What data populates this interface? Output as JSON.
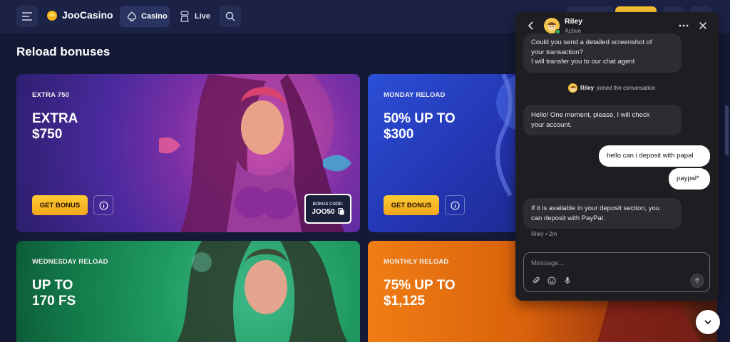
{
  "header": {
    "brand": "JooCasino",
    "nav": {
      "casino": "Casino",
      "live": "Live"
    }
  },
  "page": {
    "title": "Reload bonuses"
  },
  "cards": [
    {
      "label": "EXTRA 750",
      "headline_1": "EXTRA",
      "headline_2": "$750",
      "button": "GET BONUS",
      "code_label": "BONUS CODE:",
      "code": "JOO50"
    },
    {
      "label": "MONDAY RELOAD",
      "headline_1": "50% UP TO",
      "headline_2": "$300",
      "button": "GET BONUS"
    },
    {
      "label": "WEDNESDAY RELOAD",
      "headline_1": "UP TO",
      "headline_2": "170 FS"
    },
    {
      "label": "MONTHLY RELOAD",
      "headline_1": "75% UP TO",
      "headline_2": "$1,125"
    }
  ],
  "chat": {
    "agent_name": "Riley",
    "agent_status": "Active",
    "messages": [
      {
        "line1": "Could you send a detailed screenshot of",
        "line2": "your transaction?",
        "line3": "I will transfer you to our chat agent"
      },
      {
        "system_name": "Riley",
        "system_text": "joined the conversation"
      },
      {
        "line1": "Hello! One moment, please, I will check",
        "line2": "your account."
      },
      {
        "text": "hello can i deposit with papal"
      },
      {
        "text": "paypal*"
      },
      {
        "line1": "If it is available in your deposit section, you",
        "line2": "can deposit with PayPal."
      }
    ],
    "meta": "Riley • 2m",
    "placeholder": "Message..."
  },
  "icons": {
    "menu": "menu-icon",
    "logo": "crown-icon",
    "casino": "spade-icon",
    "live": "dealer-icon",
    "search": "search-icon",
    "info": "info-icon",
    "copy": "copy-icon",
    "back": "chevron-left-icon",
    "more": "more-icon",
    "close": "close-icon",
    "attach": "paperclip-icon",
    "emoji": "smile-icon",
    "mic": "microphone-icon",
    "send": "arrow-up-icon",
    "scroll": "chevron-down-icon"
  },
  "colors": {
    "accent": "#fbc531",
    "background": "#141a36",
    "chat_bg": "#1e1e22"
  }
}
